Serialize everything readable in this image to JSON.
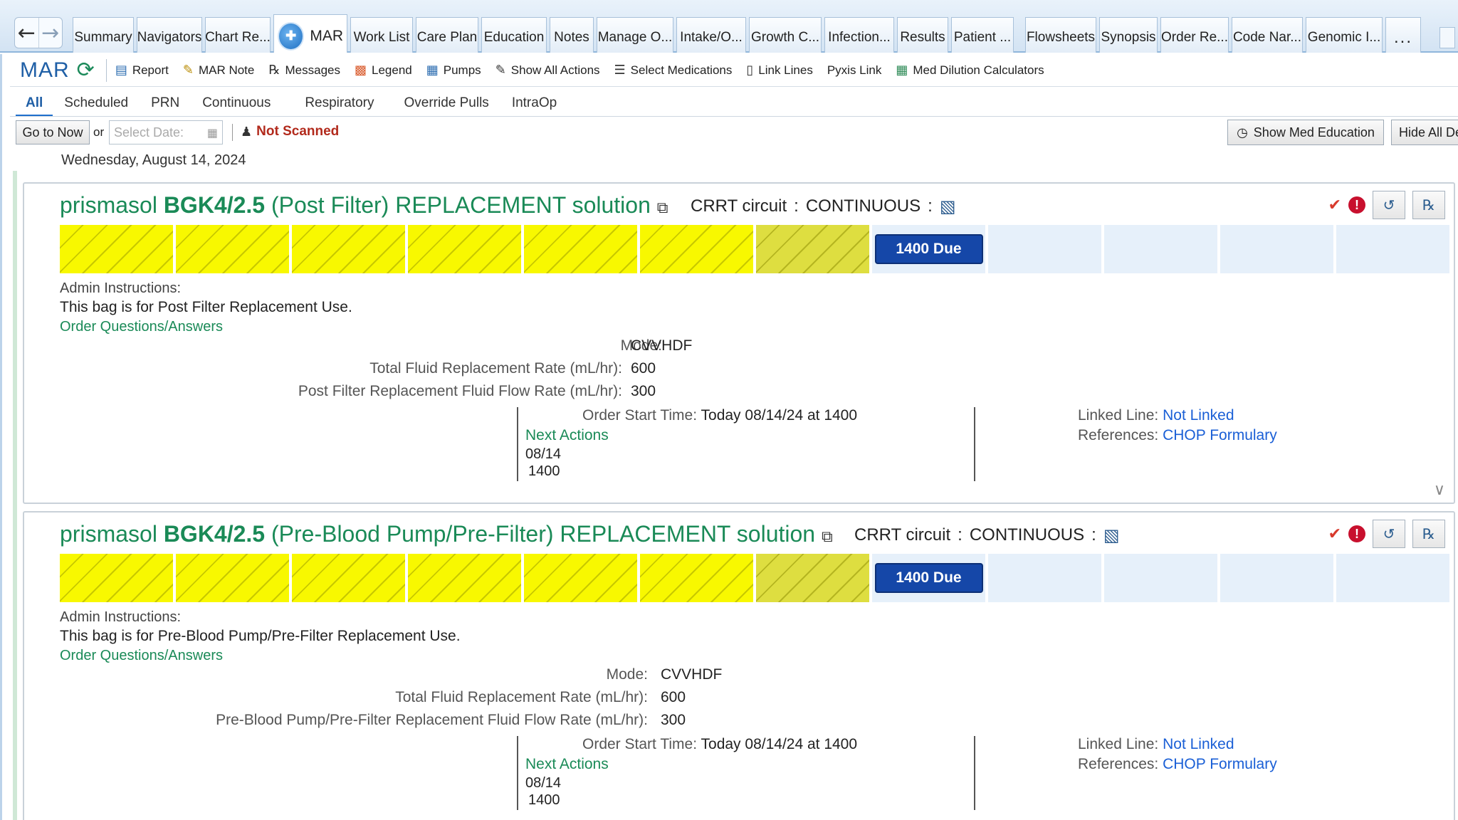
{
  "tabstrip": {
    "tabs": [
      {
        "label": "Summary"
      },
      {
        "label": "Navigators"
      },
      {
        "label": "Chart Re..."
      },
      {
        "label": "MAR",
        "active": true
      },
      {
        "label": "Work List"
      },
      {
        "label": "Care Plan"
      },
      {
        "label": "Education"
      },
      {
        "label": "Notes"
      },
      {
        "label": "Manage O..."
      },
      {
        "label": "Intake/O..."
      },
      {
        "label": "Growth C..."
      },
      {
        "label": "Infection..."
      },
      {
        "label": "Results"
      },
      {
        "label": "Patient ..."
      },
      {
        "label": "Flowsheets"
      },
      {
        "label": "Synopsis"
      },
      {
        "label": "Order Re..."
      },
      {
        "label": "Code Nar..."
      },
      {
        "label": "Genomic I..."
      }
    ],
    "more_label": "..."
  },
  "toolbar": {
    "title": "MAR",
    "buttons": [
      {
        "label": "Report",
        "icon": "report-icon"
      },
      {
        "label": "MAR Note",
        "icon": "note-icon"
      },
      {
        "label": "Messages",
        "icon": "rx-icon"
      },
      {
        "label": "Legend",
        "icon": "legend-icon"
      },
      {
        "label": "Pumps",
        "icon": "pump-icon"
      },
      {
        "label": "Show All Actions",
        "icon": "pencil-icon"
      },
      {
        "label": "Select Medications",
        "icon": "list-icon"
      },
      {
        "label": "Link Lines",
        "icon": "link-lines-icon"
      },
      {
        "label": "Pyxis Link",
        "icon": ""
      },
      {
        "label": "Med Dilution Calculators",
        "icon": "calculator-icon"
      }
    ]
  },
  "filters": {
    "tabs": [
      "All",
      "Scheduled",
      "PRN",
      "Continuous",
      "Respiratory",
      "Override Pulls",
      "IntraOp"
    ],
    "active": "All"
  },
  "date_controls": {
    "go_to_now": "Go to Now",
    "or_label": "or",
    "select_date_placeholder": "Select Date:",
    "not_scanned": "Not Scanned",
    "show_med_education": "Show Med Education",
    "hide_all": "Hide All De"
  },
  "date_heading": "Wednesday, August 14, 2024",
  "medications": [
    {
      "name_prefix": "prismasol ",
      "strength": "BGK4/2.5",
      "name_suffix": "  (Post Filter) REPLACEMENT solution",
      "route": "CRRT circuit",
      "route_sep": ":",
      "frequency": "CONTINUOUS",
      "frequency_sep": ":",
      "due_label": "1400 Due",
      "admin_label": "Admin Instructions:",
      "admin_text": "This bag is for Post Filter Replacement Use.",
      "oqa_link": "Order Questions/Answers",
      "params": [
        {
          "label": "Mode:",
          "value": "CVVHDF"
        },
        {
          "label": "Total Fluid Replacement Rate (mL/hr):",
          "value": "600"
        },
        {
          "label": "Post Filter Replacement Fluid Flow Rate (mL/hr):",
          "value": "300"
        }
      ],
      "order_start_label": "Order Start Time:",
      "order_start_value": "Today 08/14/24 at 1400",
      "next_actions_label": "Next Actions",
      "next_date": "08/14",
      "next_time": "1400",
      "linked_line_label": "Linked Line:",
      "linked_line_value": "Not Linked",
      "references_label": "References:",
      "references_value": "CHOP Formulary"
    },
    {
      "name_prefix": "prismasol ",
      "strength": "BGK4/2.5",
      "name_suffix": " (Pre-Blood Pump/Pre-Filter) REPLACEMENT solution",
      "route": "CRRT circuit",
      "route_sep": ":",
      "frequency": "CONTINUOUS",
      "frequency_sep": ":",
      "due_label": "1400 Due",
      "admin_label": "Admin Instructions:",
      "admin_text": "This bag is for Pre-Blood Pump/Pre-Filter Replacement Use.",
      "oqa_link": "Order Questions/Answers",
      "params": [
        {
          "label": "Mode:",
          "value": "CVVHDF"
        },
        {
          "label": "Total Fluid Replacement Rate (mL/hr):",
          "value": "600"
        },
        {
          "label": "Pre-Blood Pump/Pre-Filter Replacement Fluid Flow Rate (mL/hr):",
          "value": "300"
        }
      ],
      "order_start_label": "Order Start Time:",
      "order_start_value": "Today 08/14/24 at 1400",
      "next_actions_label": "Next Actions",
      "next_date": "08/14",
      "next_time": "1400",
      "linked_line_label": "Linked Line:",
      "linked_line_value": "Not Linked",
      "references_label": "References:",
      "references_value": "CHOP Formulary"
    }
  ]
}
